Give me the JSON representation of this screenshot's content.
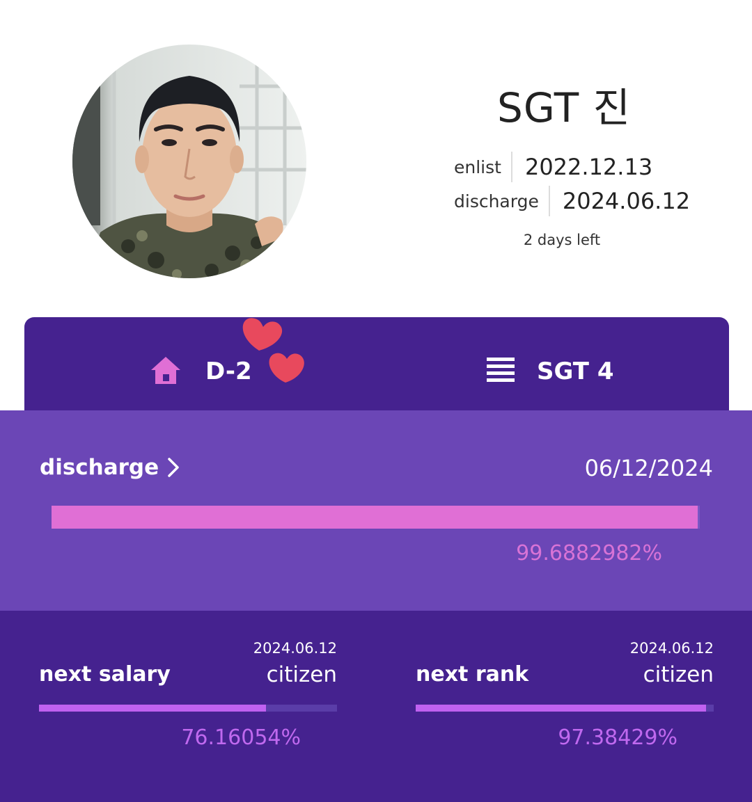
{
  "profile": {
    "name": "SGT 진",
    "enlist_label": "enlist",
    "enlist_date": "2022.12.13",
    "discharge_label": "discharge",
    "discharge_date": "2024.06.12",
    "days_left": "2 days left"
  },
  "tabs": [
    {
      "icon": "home-icon",
      "label": "D-2"
    },
    {
      "icon": "list-icon",
      "label": "SGT 4"
    }
  ],
  "discharge_card": {
    "title": "discharge",
    "date": "06/12/2024",
    "progress": 0.996882982,
    "percent_text": "99.6882982%"
  },
  "stats": [
    {
      "label": "next salary",
      "date": "2024.06.12",
      "value": "citizen",
      "progress": 0.7616054,
      "percent_text": "76.16054%"
    },
    {
      "label": "next rank",
      "date": "2024.06.12",
      "value": "citizen",
      "progress": 0.9738429,
      "percent_text": "97.38429%"
    }
  ],
  "colors": {
    "header_bg": "#45228f",
    "card_bg": "#6b46b6",
    "progress_pink": "#e06fd5",
    "progress_purple": "#c061f0",
    "heart": "#e8495d"
  }
}
